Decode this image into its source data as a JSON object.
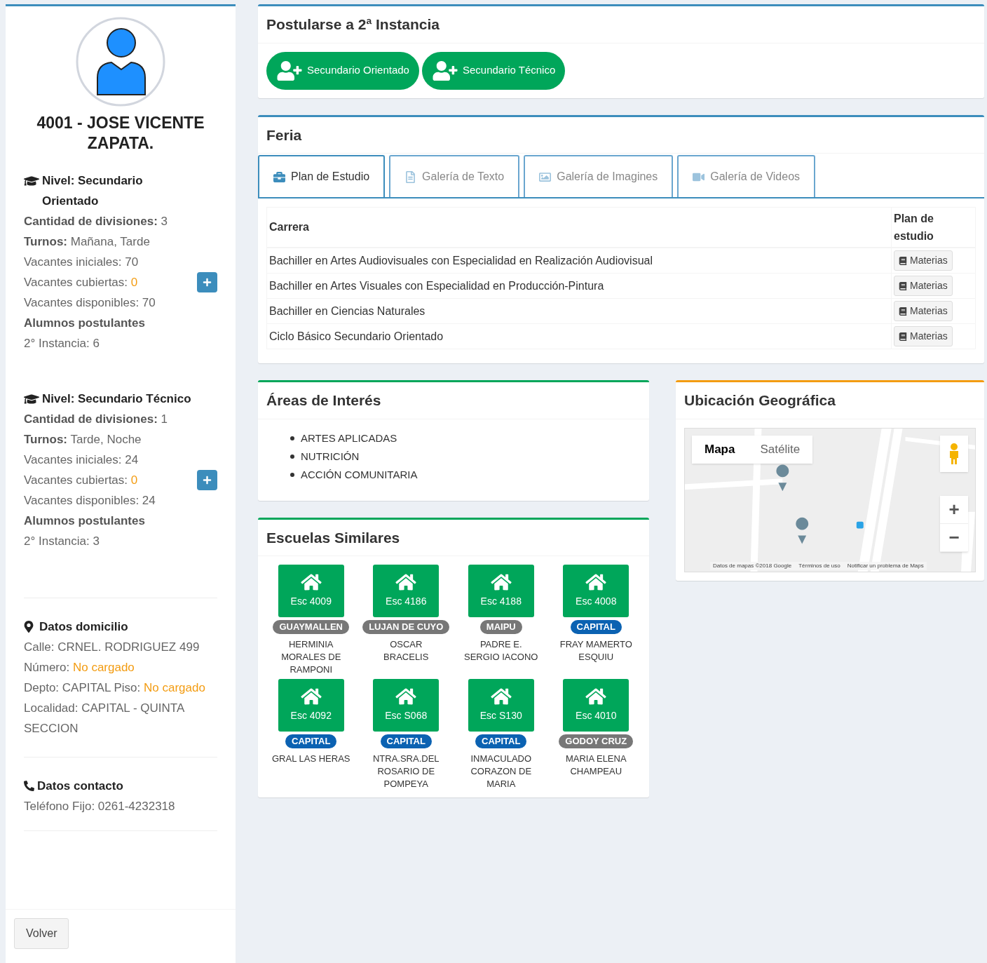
{
  "profile": {
    "title": "4001 - JOSE VICENTE ZAPATA."
  },
  "levels": [
    {
      "title": "Nivel: Secundario Orientado",
      "lines": [
        {
          "label": "Cantidad de divisiones:",
          "value": "3",
          "kind": "strong"
        },
        {
          "label": "Turnos:",
          "value": "Mañana, Tarde",
          "kind": "strong"
        },
        {
          "label": "Vacantes iniciales:",
          "value": "70",
          "kind": "plain"
        },
        {
          "label": "Vacantes cubiertas:",
          "value": "0",
          "kind": "warn",
          "add_button": true
        },
        {
          "label": "Vacantes disponibles:",
          "value": "70",
          "kind": "plain"
        },
        {
          "label": "Alumnos postulantes",
          "kind": "heading"
        },
        {
          "label": "2° Instancia:",
          "value": "6",
          "kind": "plain"
        }
      ]
    },
    {
      "title": "Nivel: Secundario Técnico",
      "lines": [
        {
          "label": "Cantidad de divisiones:",
          "value": "1",
          "kind": "strong"
        },
        {
          "label": "Turnos:",
          "value": "Tarde, Noche",
          "kind": "strong"
        },
        {
          "label": "Vacantes iniciales:",
          "value": "24",
          "kind": "plain"
        },
        {
          "label": "Vacantes cubiertas:",
          "value": "0",
          "kind": "warn",
          "add_button": true
        },
        {
          "label": "Vacantes disponibles:",
          "value": "24",
          "kind": "plain"
        },
        {
          "label": "Alumnos postulantes",
          "kind": "heading"
        },
        {
          "label": "2° Instancia:",
          "value": "3",
          "kind": "plain"
        }
      ]
    }
  ],
  "domicilio": {
    "title": "Datos domicilio",
    "lines": [
      {
        "label": "Calle: CRNEL. RODRIGUEZ 499"
      },
      {
        "label": "Número:",
        "missing_value": "No cargado"
      },
      {
        "label": "Depto: CAPITAL Piso:",
        "missing_value": "No cargado"
      },
      {
        "label": "Localidad: CAPITAL - QUINTA SECCION"
      }
    ]
  },
  "contacto": {
    "title": "Datos contacto",
    "lines": [
      {
        "label": "Teléfono Fijo: 0261-4232318"
      }
    ]
  },
  "back_button": "Volver",
  "postular": {
    "title": "Postularse a 2ª Instancia",
    "buttons": [
      "Secundario Orientado",
      "Secundario Técnico"
    ]
  },
  "feria": {
    "title": "Feria",
    "tabs": [
      {
        "label": "Plan de Estudio",
        "selected": true
      },
      {
        "label": "Galería de Texto",
        "selected": false
      },
      {
        "label": "Galería de Imagines",
        "selected": false
      },
      {
        "label": "Galería de Videos",
        "selected": false
      }
    ],
    "table": {
      "columns": [
        "Carrera",
        "Plan de estudio"
      ],
      "rows": [
        {
          "carrera": "Bachiller en Artes Audiovisuales con Especialidad en Realización Audiovisual",
          "button": "Materias"
        },
        {
          "carrera": "Bachiller en Artes Visuales con Especialidad en Producción-Pintura",
          "button": "Materias"
        },
        {
          "carrera": "Bachiller en Ciencias Naturales",
          "button": "Materias"
        },
        {
          "carrera": "Ciclo Básico Secundario Orientado",
          "button": "Materias"
        }
      ]
    }
  },
  "areas": {
    "title": "Áreas de Interés",
    "items": [
      "ARTES APLICADAS",
      "NUTRICIÓN",
      "ACCIÓN COMUNITARIA"
    ]
  },
  "escuelas": {
    "title": "Escuelas Similares",
    "items": [
      {
        "code": "Esc 4009",
        "region": "GUAYMALLEN",
        "color": "#777777",
        "name": "HERMINIA MORALES DE RAMPONI"
      },
      {
        "code": "Esc 4186",
        "region": "LUJAN DE CUYO",
        "color": "#777777",
        "name": "OSCAR BRACELIS"
      },
      {
        "code": "Esc 4188",
        "region": "MAIPU",
        "color": "#777777",
        "name": "PADRE E. SERGIO IACONO"
      },
      {
        "code": "Esc 4008",
        "region": "CAPITAL",
        "color": "#0b62b2",
        "name": "FRAY MAMERTO ESQUIU"
      },
      {
        "code": "Esc 4092",
        "region": "CAPITAL",
        "color": "#0b62b2",
        "name": "GRAL LAS HERAS"
      },
      {
        "code": "Esc S068",
        "region": "CAPITAL",
        "color": "#0b62b2",
        "name": "NTRA.SRA.DEL ROSARIO DE POMPEYA"
      },
      {
        "code": "Esc S130",
        "region": "CAPITAL",
        "color": "#0b62b2",
        "name": "INMACULADO CORAZON DE MARIA"
      },
      {
        "code": "Esc 4010",
        "region": "GODOY CRUZ",
        "color": "#777777",
        "name": "MARIA ELENA CHAMPEAU"
      }
    ]
  },
  "ubicacion": {
    "title": "Ubicación Geográfica",
    "map_types": [
      {
        "label": "Mapa",
        "selected": true
      },
      {
        "label": "Satélite",
        "selected": false
      }
    ],
    "zoom_buttons": [
      "+",
      "−"
    ],
    "footer": [
      "Datos de mapas ©2018 Google",
      "Términos de uso",
      "Notificar un problema de Maps"
    ]
  }
}
